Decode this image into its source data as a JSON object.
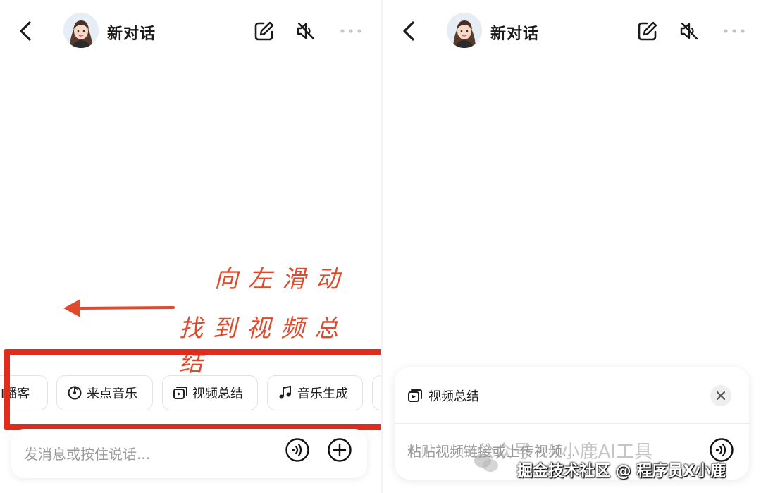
{
  "left": {
    "header": {
      "title": "新对话"
    },
    "annotation": {
      "line1": "向左滑动",
      "line2": "找到视频总结"
    },
    "chips": [
      {
        "label": "I播客",
        "icon": "podcast-icon"
      },
      {
        "label": "来点音乐",
        "icon": "music-disc-icon"
      },
      {
        "label": "视频总结",
        "icon": "video-summary-icon"
      },
      {
        "label": "音乐生成",
        "icon": "music-note-icon"
      }
    ],
    "input": {
      "placeholder": "发消息或按住说话..."
    }
  },
  "right": {
    "header": {
      "title": "新对话"
    },
    "card": {
      "mode_label": "视频总结",
      "placeholder": "粘贴视频链接或上传视频..."
    }
  },
  "watermark": {
    "text": "公众号 · X小鹿AI工具"
  },
  "credit": {
    "text": "掘金技术社区 @ 程序员X小鹿"
  },
  "colors": {
    "accent": "#e32b1c",
    "annotation": "#e04a2c",
    "placeholder": "#9a9a9a"
  }
}
